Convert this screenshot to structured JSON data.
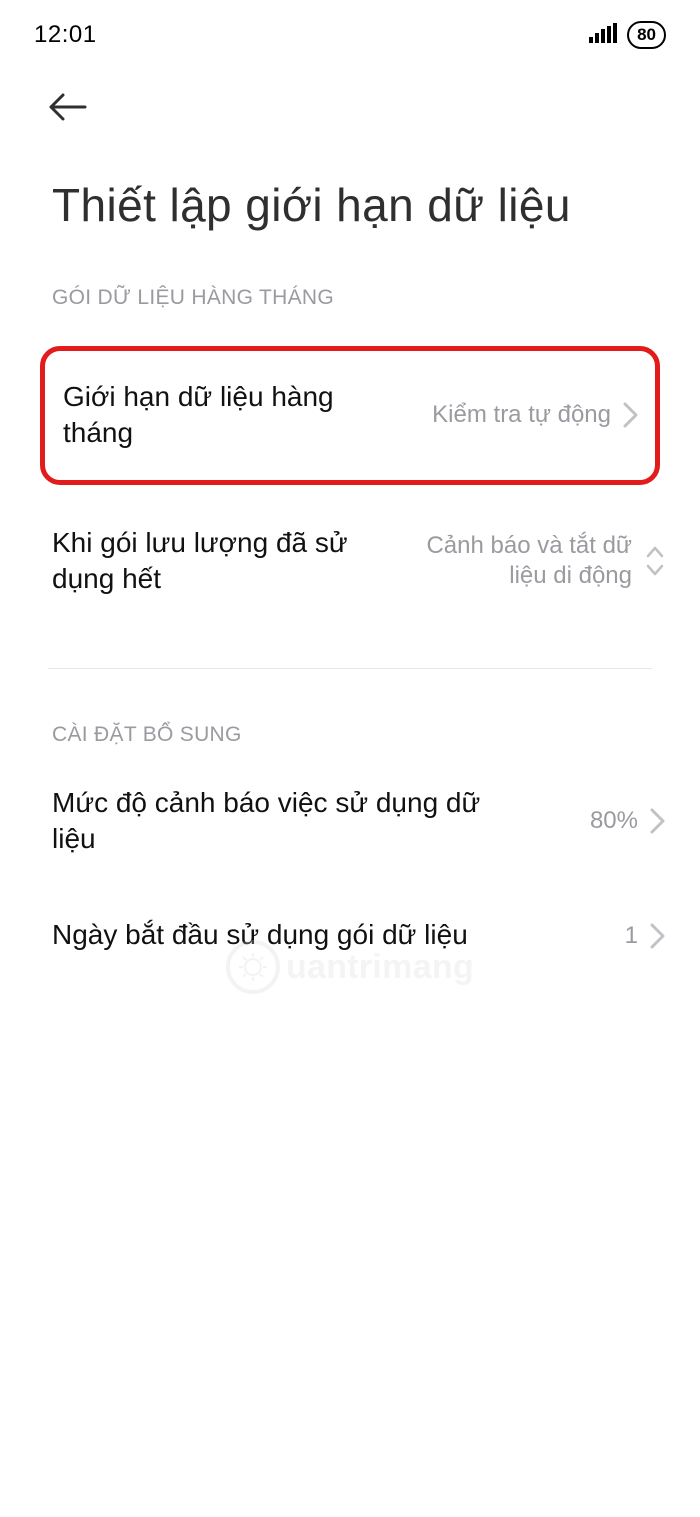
{
  "status_bar": {
    "time": "12:01",
    "battery": "80"
  },
  "page": {
    "title": "Thiết lập giới hạn dữ liệu"
  },
  "sections": {
    "monthly": {
      "header": "GÓI DỮ LIỆU HÀNG THÁNG",
      "items": [
        {
          "label": "Giới hạn dữ liệu hàng tháng",
          "value": "Kiểm tra tự động"
        },
        {
          "label": "Khi gói lưu lượng đã sử dụng hết",
          "value": "Cảnh báo và tắt dữ liệu di động"
        }
      ]
    },
    "additional": {
      "header": "CÀI ĐẶT BỔ SUNG",
      "items": [
        {
          "label": "Mức độ cảnh báo việc sử dụng dữ liệu",
          "value": "80%"
        },
        {
          "label": "Ngày bắt đầu sử dụng gói dữ liệu",
          "value": "1"
        }
      ]
    }
  },
  "watermark": {
    "text": "uantrimang"
  }
}
